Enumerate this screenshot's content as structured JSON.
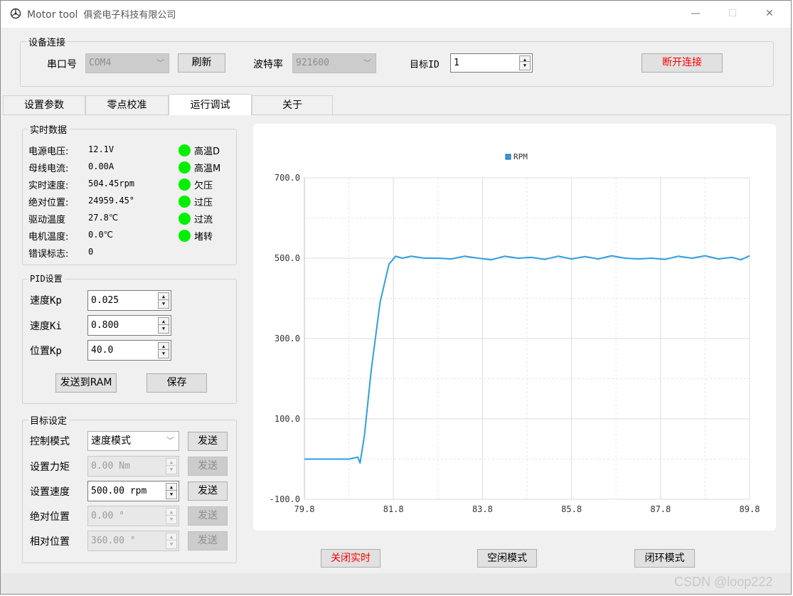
{
  "window": {
    "app_title": "Motor tool",
    "company": "俱瓷电子科技有限公司",
    "minimize": "—",
    "maximize": "☐",
    "close": "✕"
  },
  "connection": {
    "group_title": "设备连接",
    "port_label": "串口号",
    "port_value": "COM4",
    "refresh_label": "刷新",
    "baud_label": "波特率",
    "baud_value": "921600",
    "target_id_label": "目标ID",
    "target_id_value": "1",
    "disconnect_label": "断开连接"
  },
  "tabs": [
    {
      "label": "设置参数",
      "active": false
    },
    {
      "label": "零点校准",
      "active": false
    },
    {
      "label": "运行调试",
      "active": true
    },
    {
      "label": "关于",
      "active": false
    }
  ],
  "realtime": {
    "group_title": "实时数据",
    "rows": [
      {
        "label": "电源电压:",
        "value": "12.1V"
      },
      {
        "label": "母线电流:",
        "value": "0.00A"
      },
      {
        "label": "实时速度:",
        "value": "504.45rpm"
      },
      {
        "label": "绝对位置:",
        "value": "24959.45°"
      },
      {
        "label": "驱动温度",
        "value": "27.8℃"
      },
      {
        "label": "电机温度:",
        "value": "0.0℃"
      },
      {
        "label": "错误标志:",
        "value": "0"
      }
    ],
    "flags": [
      {
        "label": "高温D",
        "color": "#00f000"
      },
      {
        "label": "高温M",
        "color": "#00f000"
      },
      {
        "label": "欠压",
        "color": "#00f000"
      },
      {
        "label": "过压",
        "color": "#00f000"
      },
      {
        "label": "过流",
        "color": "#00f000"
      },
      {
        "label": "堵转",
        "color": "#00f000"
      }
    ]
  },
  "pid": {
    "group_title": "PID设置",
    "kp_label": "速度Kp",
    "kp_value": "0.025",
    "ki_label": "速度Ki",
    "ki_value": "0.800",
    "pos_kp_label": "位置Kp",
    "pos_kp_value": "40.0",
    "send_ram_label": "发送到RAM",
    "save_label": "保存"
  },
  "target": {
    "group_title": "目标设定",
    "mode_label": "控制模式",
    "mode_value": "速度模式",
    "torque_label": "设置力矩",
    "torque_value": "0.00 Nm",
    "speed_label": "设置速度",
    "speed_value": "500.00 rpm",
    "abs_pos_label": "绝对位置",
    "abs_pos_value": "0.00 °",
    "rel_pos_label": "相对位置",
    "rel_pos_value": "360.00 °",
    "send_label": "发送"
  },
  "bottom_buttons": {
    "close_realtime": "关闭实时",
    "idle_mode": "空闲模式",
    "closed_loop_mode": "闭环模式"
  },
  "watermark": "CSDN @loop222",
  "chart_data": {
    "type": "line",
    "title": "",
    "xlabel": "",
    "ylabel": "",
    "xlim": [
      79.8,
      89.8
    ],
    "ylim": [
      -100,
      700
    ],
    "x_ticks": [
      79.8,
      81.8,
      83.8,
      85.8,
      87.8,
      89.8
    ],
    "x_tick_labels": [
      "79.8",
      "81.8",
      "83.8",
      "85.8",
      "87.8",
      "89.8"
    ],
    "y_ticks": [
      -100,
      100,
      300,
      500,
      700
    ],
    "y_tick_labels": [
      "-100.0",
      "100.0",
      "300.0",
      "500.0",
      "700.0"
    ],
    "grid": true,
    "legend": "top-center",
    "series": [
      {
        "name": "RPM",
        "color": "#2f9ee0",
        "x": [
          79.8,
          80.8,
          81.0,
          81.05,
          81.15,
          81.3,
          81.5,
          81.7,
          81.85,
          82.0,
          82.2,
          82.5,
          82.8,
          83.1,
          83.4,
          83.7,
          84.0,
          84.3,
          84.6,
          84.9,
          85.2,
          85.5,
          85.8,
          86.1,
          86.4,
          86.7,
          87.0,
          87.3,
          87.6,
          87.9,
          88.2,
          88.5,
          88.8,
          89.1,
          89.4,
          89.6,
          89.8
        ],
        "y": [
          0,
          0,
          5,
          -10,
          60,
          220,
          390,
          485,
          505,
          500,
          505,
          500,
          500,
          498,
          505,
          500,
          496,
          505,
          500,
          502,
          497,
          505,
          498,
          504,
          498,
          506,
          500,
          498,
          500,
          497,
          505,
          500,
          506,
          498,
          502,
          496,
          506
        ]
      }
    ]
  }
}
